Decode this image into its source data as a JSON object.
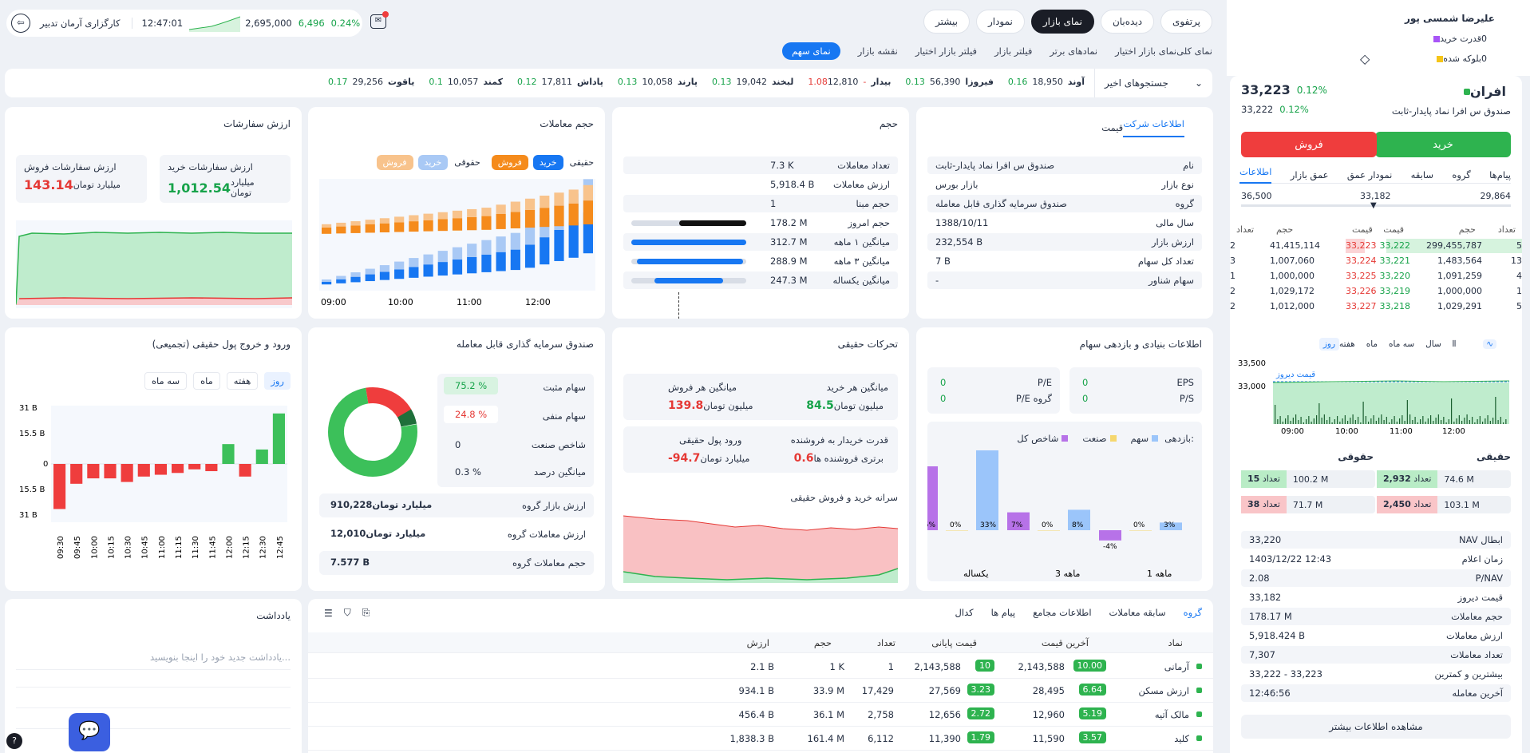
{
  "user": {
    "name": "علیرضا شمسی پور",
    "purchase_power_label": "قدرت خرید",
    "purchase_power": "0",
    "blocked_label": "بلوکه شده",
    "blocked": "0"
  },
  "top_tabs": [
    "پرتفوی",
    "دیده‌بان",
    "نمای بازار",
    "نمودار",
    "بیشتر"
  ],
  "sub_tabs": [
    "نمای کلی",
    "نمای بازار اختیار",
    "نمادهای برتر",
    "فیلتر بازار",
    "فیلتر بازار اختیار",
    "نقشه بازار",
    "نمای سهم"
  ],
  "ticker": {
    "pct": "0.24%",
    "change": "6,496",
    "value": "2,695,000",
    "time": "12:47:01",
    "broker": "کارگزاری آرمان تدبیر"
  },
  "search": {
    "label": "جستجوهای اخیر",
    "items": [
      {
        "name": "آوند",
        "pct": "0.16",
        "price": "18,950"
      },
      {
        "name": "فیروزا",
        "pct": "0.13",
        "price": "56,390"
      },
      {
        "name": "بیدار",
        "pct": "-1.08",
        "price": "12,810"
      },
      {
        "name": "لبخند",
        "pct": "0.13",
        "price": "19,042"
      },
      {
        "name": "پارند",
        "pct": "0.13",
        "price": "10,058"
      },
      {
        "name": "پاداش",
        "pct": "0.12",
        "price": "17,811"
      },
      {
        "name": "کمند",
        "pct": "0.1",
        "price": "10,057"
      },
      {
        "name": "یاقوت",
        "pct": "0.17",
        "price": "29,256"
      }
    ]
  },
  "symbol": {
    "name": "افران",
    "desc": "صندوق س افرا نماد پایدار-ثابت",
    "price": "33,223",
    "pct": "0.12%",
    "close": "33,222",
    "close_pct": "0.12%"
  },
  "trade": {
    "buy": "خرید",
    "sell": "فروش"
  },
  "sym_tabs": [
    "اطلاعات",
    "عمق بازار",
    "نمودار عمق",
    "سابقه",
    "گروه",
    "پیام‌ها"
  ],
  "range": {
    "min": "29,864",
    "mid": "33,182",
    "max": "36,500"
  },
  "orderbook": {
    "headers": [
      "تعداد",
      "حجم",
      "قیمت",
      "قیمت",
      "حجم",
      "تعداد"
    ],
    "rows": [
      [
        "5",
        "299,455,787",
        "33,222",
        "33,223",
        "41,415,114",
        "2"
      ],
      [
        "13",
        "1,483,564",
        "33,221",
        "33,224",
        "1,007,060",
        "3"
      ],
      [
        "4",
        "1,091,259",
        "33,220",
        "33,225",
        "1,000,000",
        "1"
      ],
      [
        "1",
        "1,000,000",
        "33,219",
        "33,226",
        "1,029,172",
        "2"
      ],
      [
        "5",
        "1,029,291",
        "33,218",
        "33,227",
        "1,012,000",
        "2"
      ]
    ]
  },
  "chart_tabs": [
    "روز",
    "هفته",
    "ماه",
    "سه ماه",
    "سال"
  ],
  "intraday": {
    "y_top": "33,500",
    "y_mid": "33,000",
    "label": "قیمت دیروز",
    "x": [
      "09:00",
      "10:00",
      "11:00",
      "12:00"
    ]
  },
  "haghighi": {
    "title_r": "حقیقی",
    "title_l": "حقوقی",
    "buy_count_label": "تعداد",
    "buy_count": "2,932",
    "buy_vol": "74.6 M",
    "sell_count": "2,450",
    "sell_vol": "103.1 M",
    "h_buy_count": "15",
    "h_buy_vol": "100.2 M",
    "h_sell_count": "38",
    "h_sell_vol": "71.7 M"
  },
  "sym_info": [
    [
      "NAV ابطال",
      "33,220"
    ],
    [
      "زمان اعلام",
      "1403/12/22 12:43"
    ],
    [
      "P/NAV",
      "2.08"
    ],
    [
      "قیمت دیروز",
      "33,182"
    ],
    [
      "حجم معاملات",
      "178.17 M"
    ],
    [
      "ارزش معاملات",
      "5,918.424 B"
    ],
    [
      "تعداد معاملات",
      "7,307"
    ],
    [
      "بیشترین و کمترین",
      "33,222 - 33,223"
    ],
    [
      "آخرین معامله",
      "12:46:56"
    ]
  ],
  "more_info": "مشاهده اطلاعات بیشتر",
  "company": {
    "tabs": [
      "قیمت",
      "اطلاعات شرکت"
    ],
    "rows": [
      [
        "نام",
        "صندوق س افرا نماد پایدار-ثابت"
      ],
      [
        "نوع بازار",
        "بازار بورس"
      ],
      [
        "گروه",
        "صندوق سرمایه گذاری قابل معامله"
      ],
      [
        "سال مالی",
        "1388/10/11"
      ],
      [
        "ارزش بازار",
        "232,554 B"
      ],
      [
        "تعداد کل سهام",
        "7 B"
      ],
      [
        "سهام شناور",
        "-"
      ]
    ]
  },
  "volume": {
    "title": "حجم",
    "rows": [
      [
        "تعداد معاملات",
        "7.3 K"
      ],
      [
        "ارزش معاملات",
        "5,918.4 B"
      ],
      [
        "حجم مبنا",
        "1"
      ],
      [
        "حجم امروز",
        "178.2 M"
      ],
      [
        "میانگین ۱ ماهه",
        "312.7 M"
      ],
      [
        "میانگین ۳ ماهه",
        "288.9 M"
      ],
      [
        "میانگین یکساله",
        "247.3 M"
      ]
    ]
  },
  "trades_vol": {
    "title": "حجم معاملات",
    "legend": [
      "حقیقی",
      "خرید",
      "فروش",
      "حقوقی",
      "خرید",
      "فروش"
    ],
    "x": [
      "09:00",
      "10:00",
      "11:00",
      "12:00"
    ]
  },
  "order_value": {
    "title": "ارزش سفارشات",
    "buy_label": "ارزش سفارشات خرید",
    "buy": "1,012.54",
    "sell_label": "ارزش سفارشات فروش",
    "sell": "143.14",
    "unit": "میلیارد تومان"
  },
  "fundamental": {
    "title": "اطلاعات بنیادی و بازدهی سهام",
    "eps_label": "EPS",
    "eps": "0",
    "ps_label": "P/S",
    "ps": "0",
    "pe_label": "P/E",
    "pe": "0",
    "pe_g_label": "P/E گروه",
    "pe_g": "0",
    "legend": [
      "بازدهی:",
      "سهم",
      "صنعت",
      "شاخص کل"
    ],
    "groups": [
      "1 ماهه",
      "3 ماهه",
      "یکساله"
    ]
  },
  "real_moves": {
    "title": "تحرکات حقیقی",
    "avg_buy_label": "میانگین هر خرید",
    "avg_buy": "84.5",
    "avg_sell_label": "میانگین هر فروش",
    "avg_sell": "139.8",
    "unit_m": "میلیون تومان",
    "power_label": "قدرت خریدار به فروشنده",
    "power": "0.6",
    "power_note": "برتری فروشنده ها",
    "inflow_label": "ورود پول حقیقی",
    "inflow": "-94.7",
    "unit_b": "میلیارد تومان",
    "per_capita": "سرانه خرید و فروش حقیقی"
  },
  "fund": {
    "title": "صندوق سرمایه گذاری قابل معامله",
    "pos_label": "سهام مثبت",
    "pos": "75.2 %",
    "neg_label": "سهام منفی",
    "neg": "24.8 %",
    "idx_label": "شاخص صنعت",
    "idx": "0",
    "avg_label": "میانگین درصد",
    "avg": "0.3 %",
    "mcap_label": "ارزش بازار گروه",
    "mcap": "910,228",
    "mcap_unit": "میلیارد تومان",
    "val_label": "ارزش معاملات گروه",
    "val": "12,010",
    "vol_label": "حجم معاملات گروه",
    "vol": "7.577 B"
  },
  "inflow_chart": {
    "title": "ورود و خروج پول حقیقی (تجمیعی)",
    "tabs": [
      "روز",
      "هفته",
      "ماه",
      "سه ماه"
    ],
    "y": [
      "31 B",
      "15.5 B",
      "0",
      "15.5 B",
      "31 B"
    ],
    "x": [
      "09:30",
      "09:45",
      "10:00",
      "10:15",
      "10:30",
      "10:45",
      "11:00",
      "11:15",
      "11:30",
      "11:45",
      "12:00",
      "12:15",
      "12:30",
      "12:45"
    ]
  },
  "notes": {
    "title": "یادداشت",
    "placeholder": "یادداشت جدید خود را اینجا بنویسید..."
  },
  "group_table": {
    "tabs": [
      "گروه",
      "سابقه معاملات",
      "اطلاعات مجامع",
      "پیام ها",
      "کدال"
    ],
    "headers": [
      "نماد",
      "آخرین قیمت",
      "قیمت پایانی",
      "تعداد",
      "حجم",
      "ارزش"
    ],
    "rows": [
      [
        "آرمانی",
        "2,143,588",
        "10.00",
        "2,143,588",
        "10",
        "1",
        "1 K",
        "2.1 B"
      ],
      [
        "ارزش مسکن",
        "28,495",
        "6.64",
        "27,569",
        "3.23",
        "17,429",
        "33.9 M",
        "934.1 B"
      ],
      [
        "مالک آتیه",
        "12,960",
        "5.19",
        "12,656",
        "2.72",
        "2,758",
        "36.1 M",
        "456.4 B"
      ],
      [
        "کلید",
        "11,590",
        "3.57",
        "11,390",
        "1.79",
        "6,112",
        "161.4 M",
        "1,838.3 B"
      ]
    ]
  },
  "chart_data": [
    {
      "type": "bar",
      "name": "trades-volume",
      "categories": [
        "09:00",
        "",
        "",
        "",
        "",
        "",
        "",
        "",
        "",
        "",
        "",
        "",
        "",
        "",
        "",
        "",
        "",
        "",
        "12:00"
      ],
      "series": [
        {
          "name": "خرید",
          "values": [
            2,
            3,
            4,
            5,
            6,
            7,
            8,
            9,
            10,
            11,
            12,
            13,
            14,
            15,
            17,
            20,
            23,
            26,
            30
          ]
        },
        {
          "name": "فروش",
          "values": [
            7,
            8,
            9,
            10,
            11,
            12,
            13,
            14,
            15,
            16,
            17,
            18,
            20,
            22,
            24,
            26,
            28,
            30,
            33
          ]
        }
      ]
    },
    {
      "type": "bar",
      "name": "real-inflow",
      "categories": [
        "09:30",
        "09:45",
        "10:00",
        "10:15",
        "10:30",
        "10:45",
        "11:00",
        "11:15",
        "11:30",
        "11:45",
        "12:00",
        "12:15",
        "12:30",
        "12:45"
      ],
      "values": [
        -25,
        -11,
        -8,
        -8,
        -10,
        -7,
        -6,
        -5,
        -3,
        -4,
        11,
        -7,
        8,
        28
      ],
      "ylim": [
        -31,
        31
      ]
    },
    {
      "type": "bar",
      "name": "returns",
      "categories": [
        "1 ماهه",
        "3 ماهه",
        "یکساله"
      ],
      "series": [
        {
          "name": "سهم",
          "values": [
            3,
            8,
            33
          ]
        },
        {
          "name": "صنعت",
          "values": [
            0,
            0,
            0
          ]
        },
        {
          "name": "شاخص کل",
          "values": [
            -4,
            7,
            25
          ]
        }
      ]
    }
  ]
}
